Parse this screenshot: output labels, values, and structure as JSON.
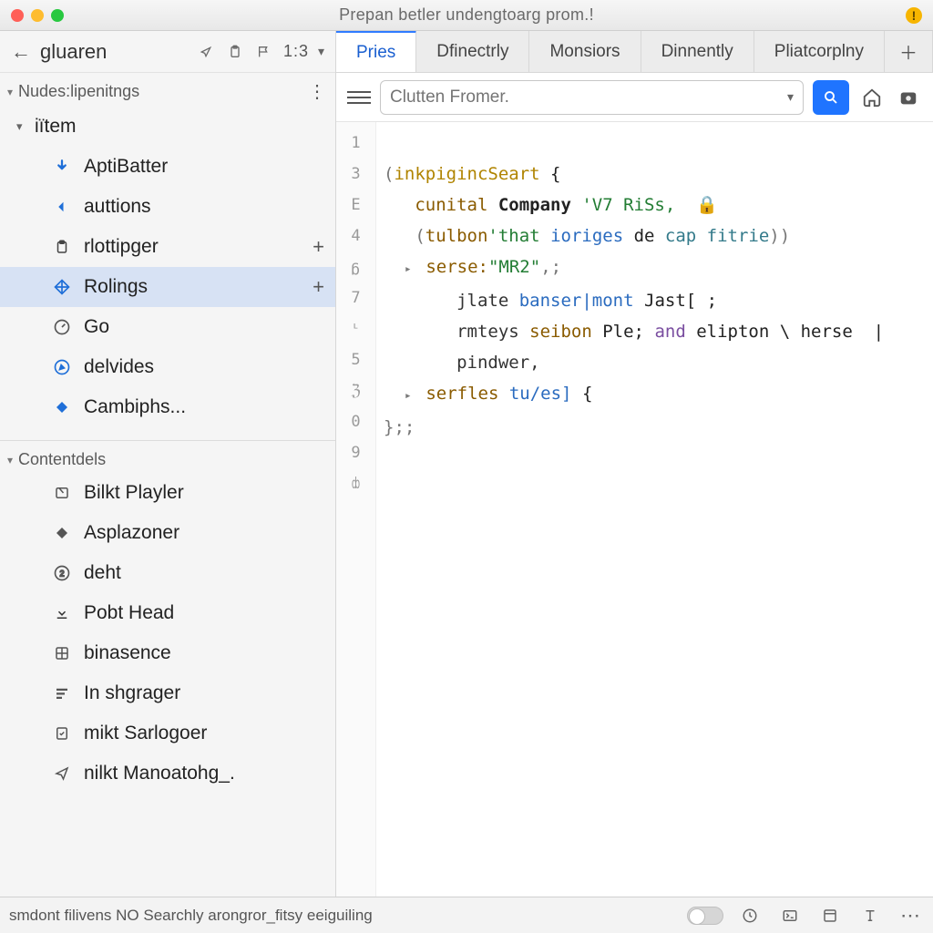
{
  "window": {
    "title": "Prepan betler undengtoarg prom.!"
  },
  "sidebar_header": {
    "crumb": "gluaren",
    "badge": "1:3"
  },
  "sections": [
    {
      "title": "Nudes:lipenitngs",
      "kebab": true,
      "root": {
        "label": "iïtem"
      },
      "items": [
        {
          "icon": "arrow-down",
          "label": "AptiBatter"
        },
        {
          "icon": "arrow-left",
          "label": "auttions"
        },
        {
          "icon": "clipboard",
          "label": "rlottipger",
          "plus": true
        },
        {
          "icon": "diamond",
          "label": "Rolings",
          "plus": true,
          "selected": true
        },
        {
          "icon": "gauge",
          "label": "Go"
        },
        {
          "icon": "compass",
          "label": "delvides"
        },
        {
          "icon": "diamond-solid",
          "label": "Cambiphs..."
        }
      ]
    },
    {
      "title": "Contentdels",
      "items": [
        {
          "icon": "card",
          "label": "Bilkt Playler"
        },
        {
          "icon": "diamond-solid-grey",
          "label": "Asplazoner"
        },
        {
          "icon": "circle-2",
          "label": "deht"
        },
        {
          "icon": "download",
          "label": "Pobt Head"
        },
        {
          "icon": "grid",
          "label": "binasence"
        },
        {
          "icon": "bars",
          "label": "In shgrager"
        },
        {
          "icon": "check-doc",
          "label": "mikt Sarlogoer"
        },
        {
          "icon": "send",
          "label": "nilkt Manoatohg_."
        }
      ]
    }
  ],
  "tabs": [
    {
      "label": "Pries",
      "active": true
    },
    {
      "label": "Dfinectrly"
    },
    {
      "label": "Monsiors"
    },
    {
      "label": "Dinnently"
    },
    {
      "label": "Pliatcorplny"
    }
  ],
  "search": {
    "placeholder": "Clutten Fromer."
  },
  "gutter": [
    "1",
    "3",
    "E",
    "4",
    "ᵷ",
    "7",
    "ᶫ",
    "5",
    "ℨ",
    "0",
    "9",
    "ȸ"
  ],
  "code": {
    "l1a": "(",
    "l1b": "inkpigincSeart",
    "l1c": " {",
    "l2a": "cunital",
    "l2b": " Company ",
    "l2c": "'V7 RiSs,",
    "l3a": "(",
    "l3b": "tulbon",
    "l3c": "'that ",
    "l3d": "ioriges",
    "l3e": " de ",
    "l3f": "cap fitrie",
    "l3g": "))",
    "l4a": "serse:",
    "l4b": "\"MR2\"",
    "l4c": ",;",
    "l5a": "jlate ",
    "l5b": "banser|mont",
    "l5c": " Jast[ ;",
    "l6a": "rmteys ",
    "l6b": "seibon",
    "l6c": " Ple; ",
    "l6d": "and",
    "l6e": " elipton \\ herse  |",
    "l7a": "pindwer,",
    "l8a": "serfles ",
    "l8b": "tu/es]",
    "l8c": " {",
    "l9a": "};;"
  },
  "status": {
    "text": "smdont filivens NO Searchly arongror_fitsy eeiguiling"
  }
}
